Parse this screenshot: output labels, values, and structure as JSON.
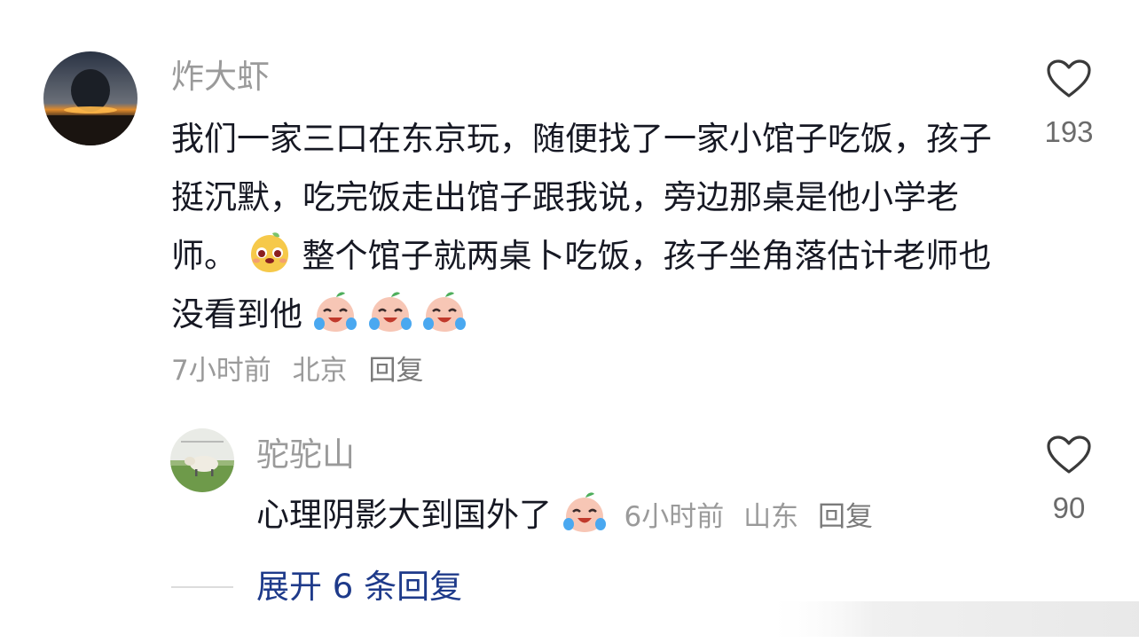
{
  "comment": {
    "username": "炸大虾",
    "text_part1": "我们一家三口在东京玩，随便找了一家小馆子吃饭，孩子挺沉默，吃完饭走出馆子跟我说，旁边那桌是他小学老师。",
    "text_part2": "整个馆子就两桌卜吃饭，孩子坐角落估计老师也没看到他",
    "time": "7小时前",
    "location": "北京",
    "reply_label": "回复",
    "like_count": "193"
  },
  "reply": {
    "username": "驼驼山",
    "text": "心理阴影大到国外了",
    "time": "6小时前",
    "location": "山东",
    "reply_label": "回复",
    "like_count": "90"
  },
  "expand": {
    "label": "展开 6 条回复"
  },
  "icons": {
    "like": "heart-outline-icon",
    "emoji_1": "smile-emoji-icon",
    "emoji_2": "cry-laugh-emoji-icon"
  },
  "colors": {
    "text": "#161823",
    "muted": "#9a9a9a",
    "expand": "#1e3a8a"
  }
}
